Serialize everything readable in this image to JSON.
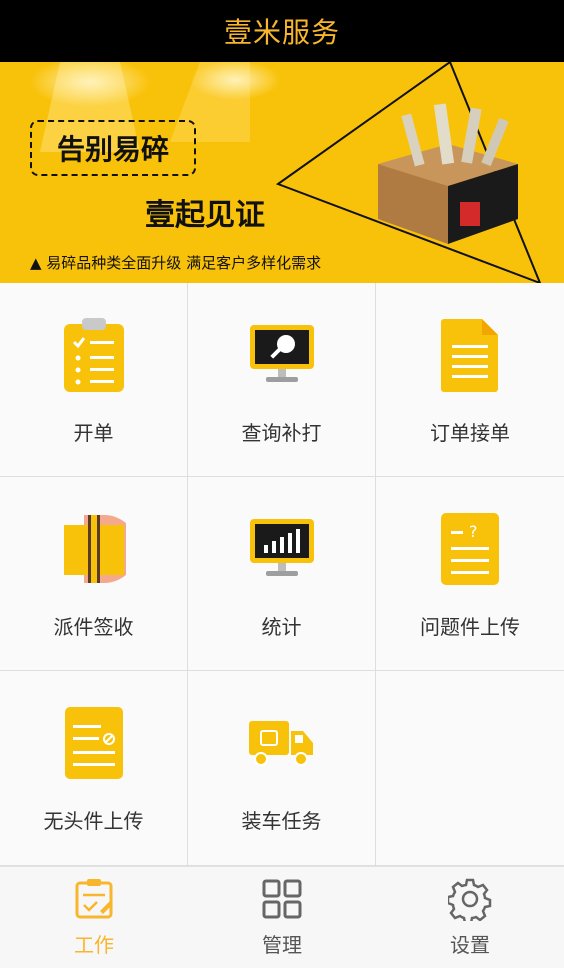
{
  "app": {
    "title": "壹米服务"
  },
  "banner": {
    "headline": "告别易碎",
    "subline": "壹起见证",
    "tagline": "▲ 易碎品种类全面升级 满足客户多样化需求"
  },
  "menu": [
    {
      "label": "开单",
      "icon": "clipboard-list-icon"
    },
    {
      "label": "查询补打",
      "icon": "monitor-search-icon"
    },
    {
      "label": "订单接单",
      "icon": "document-icon"
    },
    {
      "label": "派件签收",
      "icon": "package-sign-icon"
    },
    {
      "label": "统计",
      "icon": "monitor-chart-icon"
    },
    {
      "label": "问题件上传",
      "icon": "question-document-icon"
    },
    {
      "label": "无头件上传",
      "icon": "no-label-document-icon"
    },
    {
      "label": "装车任务",
      "icon": "truck-icon"
    }
  ],
  "tabs": [
    {
      "label": "工作",
      "icon": "work-icon",
      "active": true
    },
    {
      "label": "管理",
      "icon": "grid-icon",
      "active": false
    },
    {
      "label": "设置",
      "icon": "gear-icon",
      "active": false
    }
  ],
  "colors": {
    "accent": "#f8b62d",
    "icon_yellow": "#f9c20a",
    "header_bg": "#000000"
  }
}
